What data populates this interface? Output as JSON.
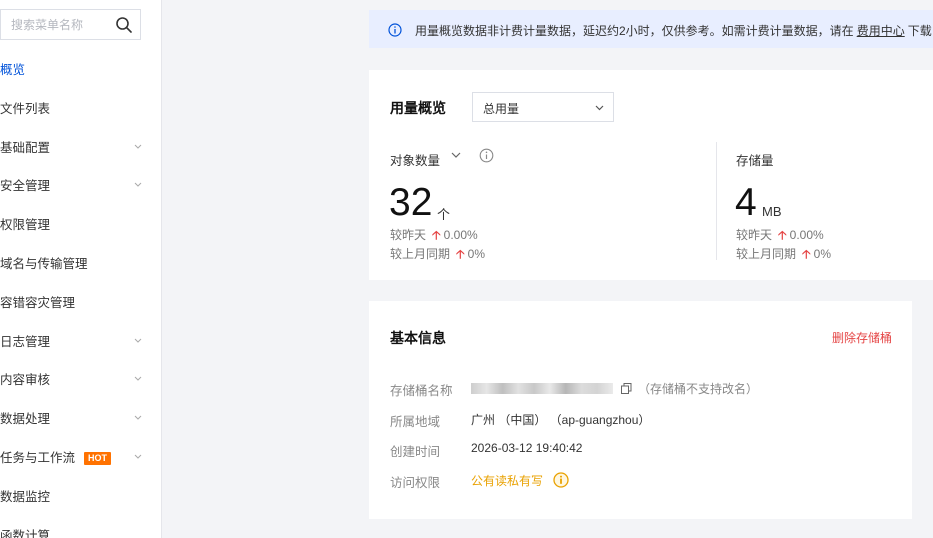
{
  "sidebar": {
    "search_placeholder": "搜索菜单名称",
    "items": [
      {
        "label": "概览",
        "active": true,
        "expandable": false
      },
      {
        "label": "文件列表",
        "expandable": false
      },
      {
        "label": "基础配置",
        "expandable": true
      },
      {
        "label": "安全管理",
        "expandable": true
      },
      {
        "label": "权限管理",
        "expandable": false
      },
      {
        "label": "域名与传输管理",
        "expandable": false
      },
      {
        "label": "容错容灾管理",
        "expandable": false
      },
      {
        "label": "日志管理",
        "expandable": true
      },
      {
        "label": "内容审核",
        "expandable": true
      },
      {
        "label": "数据处理",
        "expandable": true
      },
      {
        "label": "任务与工作流",
        "badge": "HOT",
        "expandable": true
      },
      {
        "label": "数据监控",
        "expandable": false
      },
      {
        "label": "函数计算",
        "expandable": false
      }
    ]
  },
  "notice": {
    "text_before": "用量概览数据非计费计量数据，延迟约2小时，仅供参考。如需计费计量数据，请在",
    "link": "费用中心",
    "text_after": "下载"
  },
  "usage": {
    "title": "用量概览",
    "select_value": "总用量",
    "objects": {
      "label": "对象数量",
      "value": "32",
      "unit": "个",
      "dod_label": "较昨天",
      "dod_value": "0.00%",
      "mom_label": "较上月同期",
      "mom_value": "0%"
    },
    "storage": {
      "label": "存储量",
      "value": "4",
      "unit": "MB",
      "dod_label": "较昨天",
      "dod_value": "0.00%",
      "mom_label": "较上月同期",
      "mom_value": "0%"
    }
  },
  "basic": {
    "title": "基本信息",
    "delete_label": "删除存储桶",
    "bucket_name_label": "存储桶名称",
    "bucket_rename_note": "（存储桶不支持改名）",
    "region_label": "所属地域",
    "region_value": "广州 （中国） （ap-guangzhou）",
    "created_label": "创建时间",
    "created_value": "2026-03-12 19:40:42",
    "access_label": "访问权限",
    "access_value": "公有读私有写"
  },
  "colors": {
    "primary": "#0052d9",
    "danger": "#e54545",
    "warning": "#e9a100",
    "hot": "#ff7200",
    "notice_bg": "#e8eeff"
  },
  "icons": {
    "search": "search-icon",
    "info": "info-icon",
    "chevron": "chevron-down-icon",
    "copy": "copy-icon",
    "warning": "warning-icon",
    "arrow_up": "arrow-up-icon"
  }
}
